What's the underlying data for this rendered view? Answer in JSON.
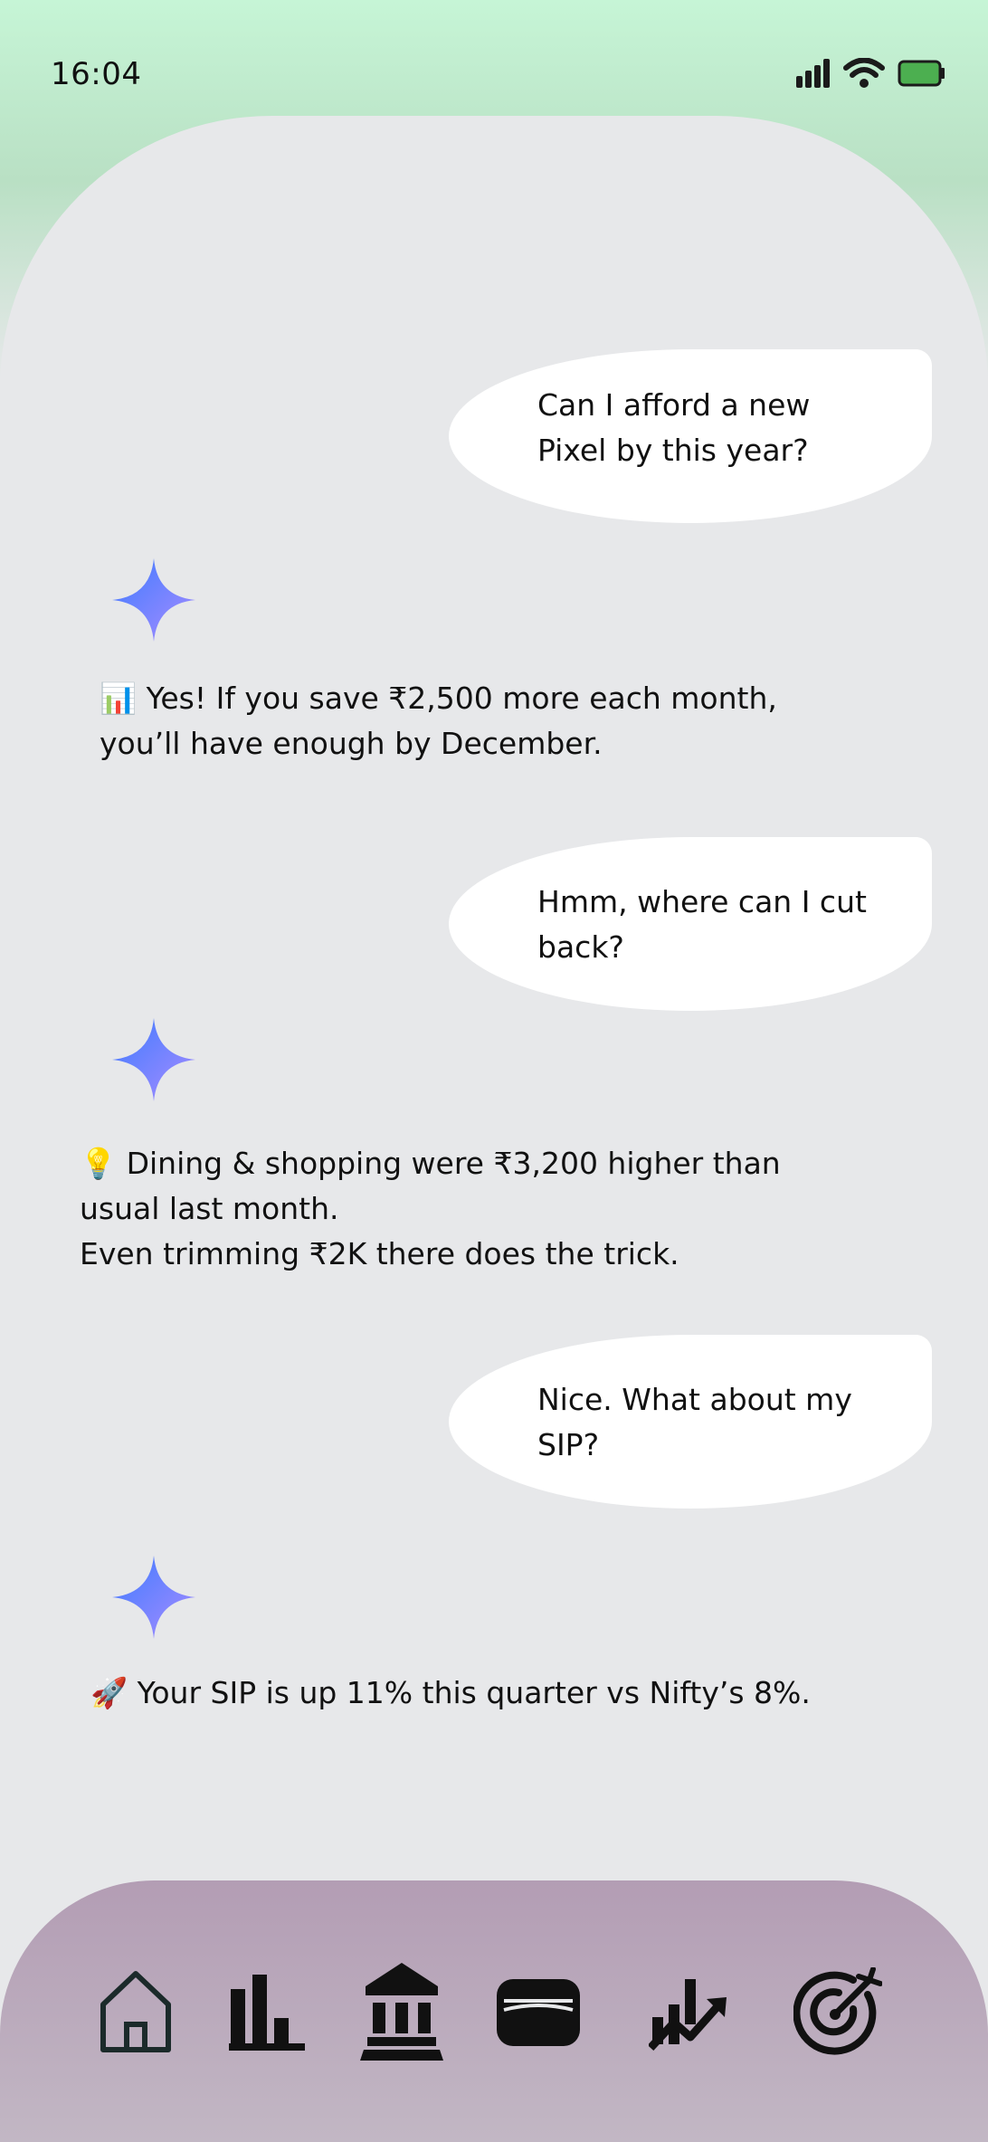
{
  "status_bar": {
    "time": "16:04"
  },
  "chat": {
    "messages": [
      {
        "role": "user",
        "text": "Can I afford a new Pixel by this year?"
      },
      {
        "role": "assistant",
        "emoji": "📊",
        "text": "Yes! If you save ₹2,500 more each month, you’ll have enough by December."
      },
      {
        "role": "user",
        "text": "Hmm, where can I cut back?"
      },
      {
        "role": "assistant",
        "emoji": "💡",
        "text": "Dining & shopping were ₹3,200 higher than usual last month.\nEven trimming ₹2K there does the trick."
      },
      {
        "role": "user",
        "text": "Nice. What about my SIP?"
      },
      {
        "role": "assistant",
        "emoji": "🚀",
        "text": "Your SIP is up 11% this quarter vs Nifty’s 8%."
      }
    ]
  },
  "bottom_nav": {
    "items": [
      {
        "icon": "home-icon"
      },
      {
        "icon": "bar-chart-icon"
      },
      {
        "icon": "bank-icon"
      },
      {
        "icon": "wallet-icon"
      },
      {
        "icon": "growth-chart-icon"
      },
      {
        "icon": "target-icon"
      }
    ]
  },
  "colors": {
    "ai_star_from": "#3d7bff",
    "ai_star_to": "#a98cff",
    "battery": "#4caf50",
    "nav_bg": "#b9a7bb"
  }
}
